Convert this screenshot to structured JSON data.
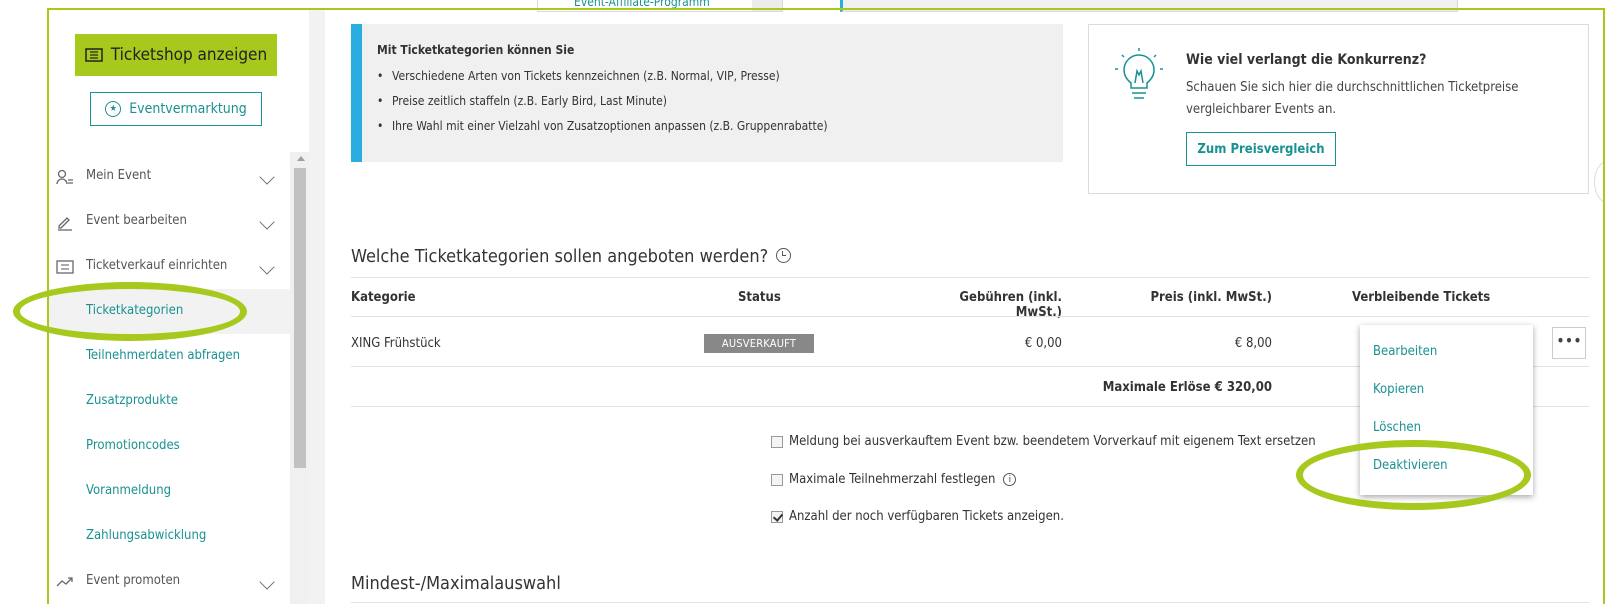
{
  "top_menu": {
    "item": "Event-Affiliate-Programm"
  },
  "sidebar": {
    "ticketshop_button": "Ticketshop anzeigen",
    "eventvermarktung_button": "Eventvermarktung",
    "main_items": [
      {
        "label": "Mein Event",
        "icon": "people-icon"
      },
      {
        "label": "Event bearbeiten",
        "icon": "pencil-icon"
      },
      {
        "label": "Ticketverkauf einrichten",
        "icon": "ticket-icon"
      }
    ],
    "sub_items": [
      {
        "label": "Ticketkategorien",
        "active": true
      },
      {
        "label": "Teilnehmerdaten abfragen"
      },
      {
        "label": "Zusatzprodukte"
      },
      {
        "label": "Promotioncodes"
      },
      {
        "label": "Voranmeldung"
      },
      {
        "label": "Zahlungsabwicklung"
      }
    ],
    "promote_item": {
      "label": "Event promoten",
      "icon": "trend-icon"
    }
  },
  "info": {
    "title": "Mit Ticketkategorien können Sie",
    "bullets": [
      "Verschiedene Arten von Tickets kennzeichnen (z.B. Normal, VIP, Presse)",
      "Preise zeitlich staffeln (z.B. Early Bird, Last Minute)",
      "Ihre Wahl mit einer Vielzahl von Zusatzoptionen anpassen (z.B. Gruppenrabatte)"
    ]
  },
  "price_compare": {
    "heading": "Wie viel verlangt die Konkurrenz?",
    "text": "Schauen Sie sich hier die durchschnittlichen Ticketpreise vergleichbarer Events an.",
    "button": "Zum Preisvergleich"
  },
  "section_title": "Welche Ticketkategorien sollen angeboten werden?",
  "table": {
    "headers": {
      "kategorie": "Kategorie",
      "status": "Status",
      "gebuehren": "Gebühren (inkl. MwSt.)",
      "preis": "Preis (inkl. MwSt.)",
      "verbleibend": "Verbleibende Tickets"
    },
    "rows": [
      {
        "kategorie": "XING Frühstück",
        "status": "AUSVERKAUFT",
        "gebuehren": "€ 0,00",
        "preis": "€ 8,00"
      }
    ],
    "max_revenue": "Maximale Erlöse € 320,00"
  },
  "dropdown": [
    "Bearbeiten",
    "Kopieren",
    "Löschen",
    "Deaktivieren"
  ],
  "options": [
    {
      "label": "Meldung bei ausverkauftem Event bzw. beendetem Vorverkauf mit eigenem Text ersetzen",
      "checked": false
    },
    {
      "label": "Maximale Teilnehmerzahl festlegen",
      "checked": false
    },
    {
      "label": "Anzahl der noch verfügbaren Tickets anzeigen.",
      "checked": true
    }
  ],
  "section2_title": "Mindest-/Maximalauswahl",
  "colors": {
    "accent_green": "#a7c81c",
    "teal": "#1a9191",
    "info_blue": "#2aaee0"
  }
}
